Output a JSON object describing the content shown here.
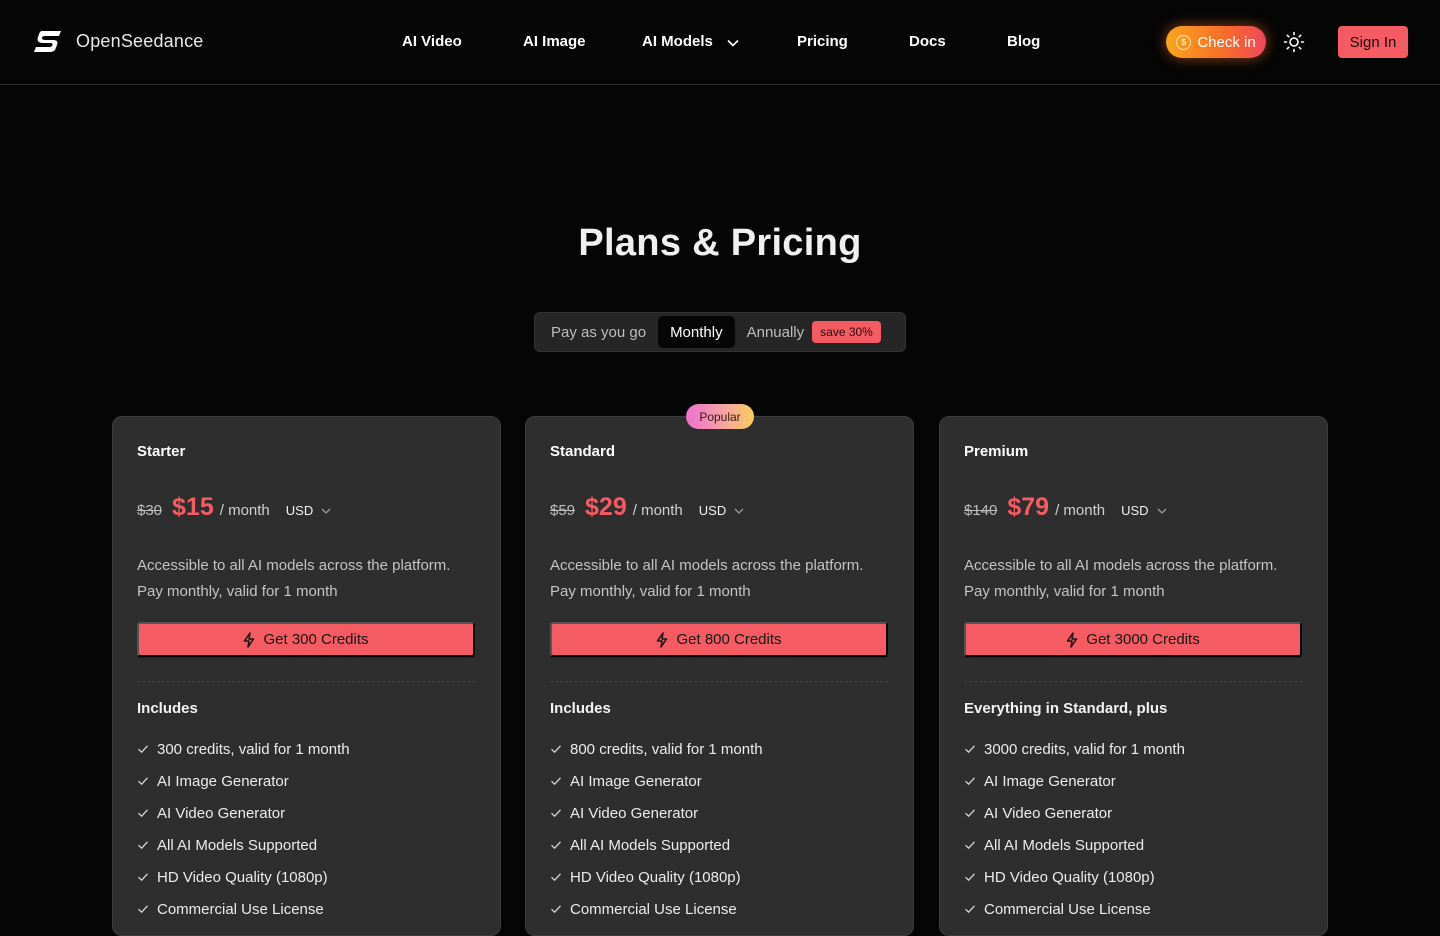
{
  "brand": {
    "name": "OpenSeedance"
  },
  "nav": {
    "items": [
      {
        "label": "AI Video"
      },
      {
        "label": "AI Image"
      },
      {
        "label": "AI Models"
      },
      {
        "label": "Pricing"
      },
      {
        "label": "Docs"
      },
      {
        "label": "Blog"
      }
    ],
    "checkin_label": "Check in",
    "signin_label": "Sign In"
  },
  "page": {
    "title": "Plans & Pricing"
  },
  "billing": {
    "options": [
      "Pay as you go",
      "Monthly",
      "Annually"
    ],
    "selected": "Monthly",
    "save_badge": "save 30%"
  },
  "popular_label": "Popular",
  "plans": [
    {
      "name": "Starter",
      "old_price": "$30",
      "price": "$15",
      "period": "/ month",
      "currency": "USD",
      "desc_line1": "Accessible to all AI models across the platform.",
      "desc_line2": "Pay monthly, valid for 1 month",
      "cta": "Get 300 Credits",
      "includes_heading": "Includes",
      "features": [
        "300 credits, valid for 1 month",
        "AI Image Generator",
        "AI Video Generator",
        "All AI Models Supported",
        "HD Video Quality (1080p)",
        "Commercial Use License"
      ]
    },
    {
      "name": "Standard",
      "old_price": "$59",
      "price": "$29",
      "period": "/ month",
      "currency": "USD",
      "desc_line1": "Accessible to all AI models across the platform.",
      "desc_line2": "Pay monthly, valid for 1 month",
      "cta": "Get 800 Credits",
      "includes_heading": "Includes",
      "features": [
        "800 credits, valid for 1 month",
        "AI Image Generator",
        "AI Video Generator",
        "All AI Models Supported",
        "HD Video Quality (1080p)",
        "Commercial Use License"
      ]
    },
    {
      "name": "Premium",
      "old_price": "$140",
      "price": "$79",
      "period": "/ month",
      "currency": "USD",
      "desc_line1": "Accessible to all AI models across the platform.",
      "desc_line2": "Pay monthly, valid for 1 month",
      "cta": "Get 3000 Credits",
      "includes_heading": "Everything in Standard, plus",
      "features": [
        "3000 credits, valid for 1 month",
        "AI Image Generator",
        "AI Video Generator",
        "All AI Models Supported",
        "HD Video Quality (1080p)",
        "Commercial Use License"
      ]
    }
  ],
  "colors": {
    "accent": "#f55b62",
    "background": "#050505",
    "card": "#2e2e2e"
  }
}
